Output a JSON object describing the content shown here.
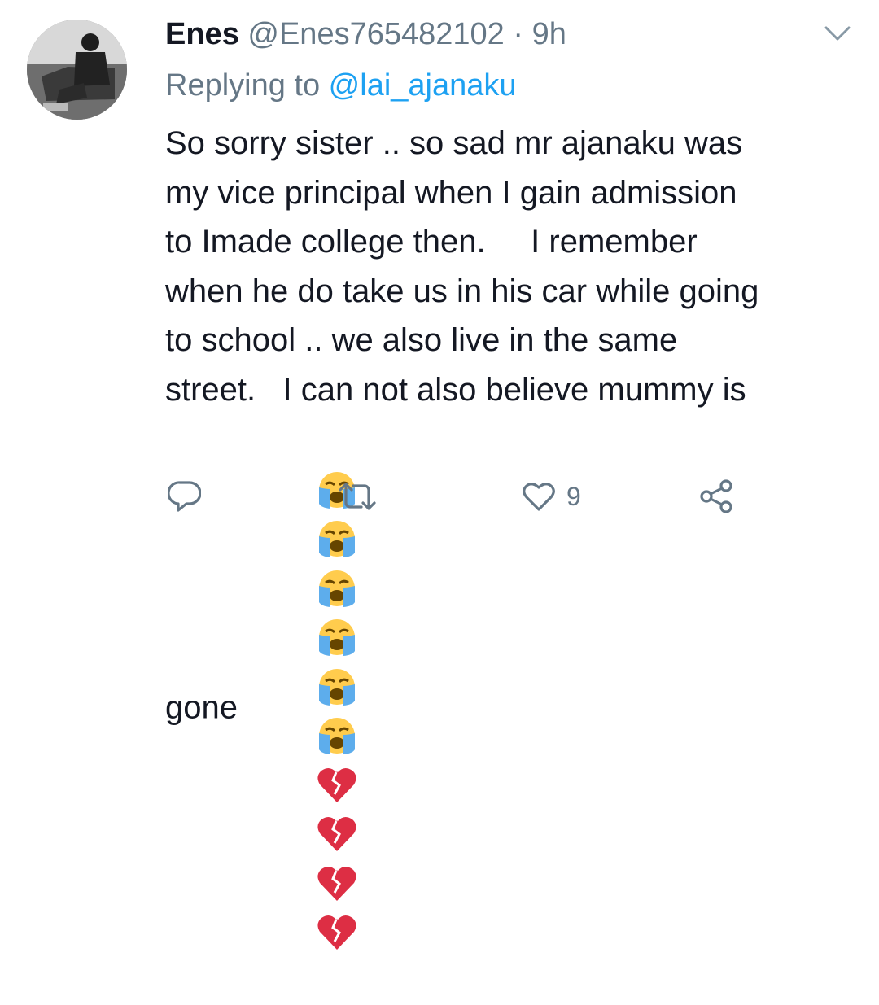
{
  "tweet": {
    "author_name": "Enes",
    "author_handle": "@Enes765482102",
    "separator": "·",
    "time": "9h",
    "reply_prefix": "Replying to ",
    "reply_mention": "@lai_ajanaku",
    "lines": [
      "So sorry sister .. so sad mr ajanaku was",
      "my vice principal when I gain admission",
      "to Imade college then.     I remember",
      "when he do take us in his car while going",
      "to school .. we also live in the same",
      "street.   I can not also believe mummy is",
      "gone"
    ],
    "emoji_sequence": [
      "loudly-crying-face",
      "loudly-crying-face",
      "loudly-crying-face",
      "loudly-crying-face",
      "loudly-crying-face",
      "loudly-crying-face",
      "broken-heart",
      "broken-heart",
      "broken-heart",
      "broken-heart"
    ]
  },
  "actions": {
    "like_count": "9"
  },
  "colors": {
    "text": "#141823",
    "secondary": "#657786",
    "mention": "#1da1f2",
    "emoji_face": "#ffcc4d",
    "emoji_tears": "#5dadec",
    "broken_heart": "#dd2e44"
  },
  "icons": {
    "chevron": "chevron-down-icon",
    "reply": "reply-icon",
    "retweet": "retweet-icon",
    "like": "heart-icon",
    "share": "share-icon"
  }
}
